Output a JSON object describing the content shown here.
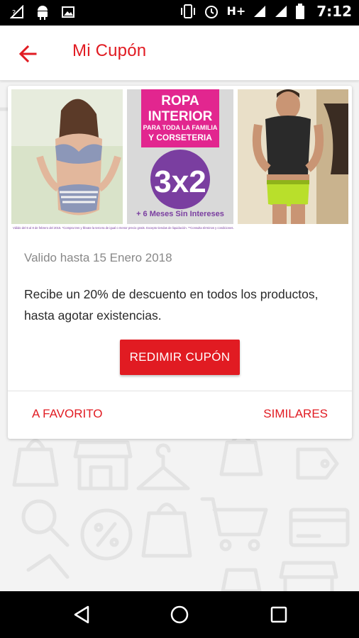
{
  "status_bar": {
    "network": "H+",
    "time": "7:12",
    "icons": [
      "signal-off-icon",
      "android-icon",
      "image-icon",
      "vibrate-icon",
      "alarm-icon",
      "network-signal-icon",
      "cell-signal-icon",
      "battery-icon"
    ]
  },
  "app_bar": {
    "title": "Mi Cupón",
    "back_icon": "arrow-back-icon"
  },
  "coupon": {
    "banner": {
      "headline_1": "ROPA",
      "headline_2": "INTERIOR",
      "subline_1": "PARA TODA LA FAMILIA",
      "subline_2": "Y CORSETERIA",
      "promo": "3x2",
      "months": "+ 6 Meses Sin Intereses",
      "fine_print": "Válido del 6 al 8 de febrero del 2015. *Compra tres y llévate la tercera de igual o menor precio gratis. Excepto tiendas de liquidación. **Consulta términos y condiciones."
    },
    "valid_until": "Valido hasta 15 Enero 2018",
    "description": "Recibe un 20% de descuento en todos los productos, hasta agotar existencias.",
    "redeem_label": "REDIMIR CUPÓN",
    "favorite_label": "A FAVORITO",
    "similar_label": "SIMILARES"
  },
  "colors": {
    "accent": "#e11b22",
    "promo_magenta": "#e2268f",
    "promo_purple": "#7a3ea0"
  }
}
